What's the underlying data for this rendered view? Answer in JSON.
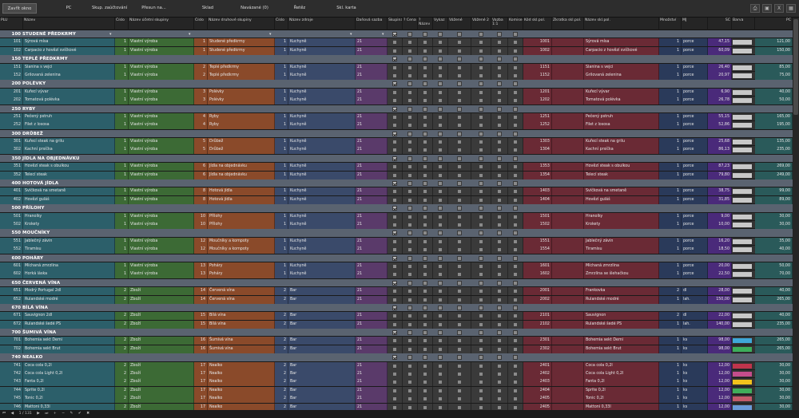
{
  "toolbar": {
    "buttons": [
      "Zavřít okno",
      "PC",
      "Skup. zaúčtování",
      "Přesun na...",
      "Sklad",
      "Navázané (0)",
      "Řetěz",
      "Skl. karta"
    ],
    "icons": [
      "print-icon",
      "printer-icon",
      "excel-icon",
      "layout-icon"
    ]
  },
  "headers": [
    "PLU",
    "Název",
    "Číslo",
    "Název účetní skupiny",
    "Číslo",
    "Název druhové skupiny",
    "Číslo",
    "Název zdroje",
    "Daňová sazba",
    "Skupina",
    "? Cena",
    "? Název",
    "Vykaz",
    "Vážené",
    "Vážené 2",
    "Vazba 1:1",
    "Komise",
    "Kód skl.pol.",
    "Zkratka skl.pol.",
    "Název skl.pol.",
    "Množství",
    "MJ",
    "SC",
    "Barva",
    "PC"
  ],
  "groups": [
    {
      "plu": "100",
      "title": "STUDENÉ PŘEDKRMY",
      "items": [
        {
          "plu": "101",
          "name": "Sýrová mísa",
          "ucet": "1",
          "ucet_name": "Vlastní výroba",
          "druh": "1",
          "druh_name": "Studené předkrmy",
          "zdroj": "1",
          "zdroj_name": "Kuchyně",
          "dph": "21",
          "kod": "1001",
          "skl_name": "Sýrová mísa",
          "mnoz": "1",
          "mj": "porce",
          "sc": "47,15",
          "barva": "",
          "pc": "121,00"
        },
        {
          "plu": "102",
          "name": "Carpacio z hovězí svíčkové",
          "ucet": "1",
          "ucet_name": "Vlastní výroba",
          "druh": "1",
          "druh_name": "Studené předkrmy",
          "zdroj": "1",
          "zdroj_name": "Kuchyně",
          "dph": "21",
          "kod": "1002",
          "skl_name": "Carpacio z hovězí svíčkové",
          "mnoz": "1",
          "mj": "porce",
          "sc": "60,09",
          "barva": "",
          "pc": "150,00"
        }
      ]
    },
    {
      "plu": "150",
      "title": "TEPLÉ PŘEDKRMY",
      "items": [
        {
          "plu": "151",
          "name": "Slanina s vejci",
          "ucet": "1",
          "ucet_name": "Vlastní výroba",
          "druh": "2",
          "druh_name": "Teplé předkrmy",
          "zdroj": "1",
          "zdroj_name": "Kuchyně",
          "dph": "21",
          "kod": "1151",
          "skl_name": "Slanina s vejci",
          "mnoz": "1",
          "mj": "porce",
          "sc": "26,40",
          "barva": "",
          "pc": "85,00"
        },
        {
          "plu": "152",
          "name": "Grilovaná zelenina",
          "ucet": "1",
          "ucet_name": "Vlastní výroba",
          "druh": "2",
          "druh_name": "Teplé předkrmy",
          "zdroj": "1",
          "zdroj_name": "Kuchyně",
          "dph": "21",
          "kod": "1152",
          "skl_name": "Grilovaná zelenina",
          "mnoz": "1",
          "mj": "porce",
          "sc": "20,97",
          "barva": "",
          "pc": "75,00"
        }
      ]
    },
    {
      "plu": "200",
      "title": "POLÉVKY",
      "items": [
        {
          "plu": "201",
          "name": "Kuřecí vývar",
          "ucet": "1",
          "ucet_name": "Vlastní výroba",
          "druh": "3",
          "druh_name": "Polévky",
          "zdroj": "1",
          "zdroj_name": "Kuchyně",
          "dph": "21",
          "kod": "1201",
          "skl_name": "Kuřecí vývar",
          "mnoz": "1",
          "mj": "porce",
          "sc": "6,90",
          "barva": "",
          "pc": "40,00"
        },
        {
          "plu": "202",
          "name": "Tomatová polévka",
          "ucet": "1",
          "ucet_name": "Vlastní výroba",
          "druh": "3",
          "druh_name": "Polévky",
          "zdroj": "1",
          "zdroj_name": "Kuchyně",
          "dph": "21",
          "kod": "1202",
          "skl_name": "Tomatová polévka",
          "mnoz": "1",
          "mj": "porce",
          "sc": "26,78",
          "barva": "",
          "pc": "50,00"
        }
      ]
    },
    {
      "plu": "250",
      "title": "RYBY",
      "items": [
        {
          "plu": "251",
          "name": "Pečený pstruh",
          "ucet": "1",
          "ucet_name": "Vlastní výroba",
          "druh": "4",
          "druh_name": "Ryby",
          "zdroj": "1",
          "zdroj_name": "Kuchyně",
          "dph": "21",
          "kod": "1251",
          "skl_name": "Pečený pstruh",
          "mnoz": "1",
          "mj": "porce",
          "sc": "55,15",
          "barva": "",
          "pc": "165,00"
        },
        {
          "plu": "252",
          "name": "Filet z lososa",
          "ucet": "1",
          "ucet_name": "Vlastní výroba",
          "druh": "4",
          "druh_name": "Ryby",
          "zdroj": "1",
          "zdroj_name": "Kuchyně",
          "dph": "21",
          "kod": "1252",
          "skl_name": "Filet z lososa",
          "mnoz": "1",
          "mj": "porce",
          "sc": "52,86",
          "barva": "",
          "pc": "195,00"
        }
      ]
    },
    {
      "plu": "300",
      "title": "DRŮBEŽ",
      "items": [
        {
          "plu": "301",
          "name": "Kuřecí steak na grilu",
          "ucet": "1",
          "ucet_name": "Vlastní výroba",
          "druh": "5",
          "druh_name": "Drůbež",
          "zdroj": "1",
          "zdroj_name": "Kuchyně",
          "dph": "21",
          "kod": "1303",
          "skl_name": "Kuřecí steak na grilu",
          "mnoz": "1",
          "mj": "porce",
          "sc": "25,68",
          "barva": "",
          "pc": "135,00"
        },
        {
          "plu": "302",
          "name": "Kachní prsíčka",
          "ucet": "1",
          "ucet_name": "Vlastní výroba",
          "druh": "5",
          "druh_name": "Drůbež",
          "zdroj": "1",
          "zdroj_name": "Kuchyně",
          "dph": "21",
          "kod": "1304",
          "skl_name": "Kachní prsíčka",
          "mnoz": "1",
          "mj": "porce",
          "sc": "86,13",
          "barva": "",
          "pc": "235,00"
        }
      ]
    },
    {
      "plu": "350",
      "title": "JÍDLA NA OBJEDNÁVKU",
      "items": [
        {
          "plu": "351",
          "name": "Hovězí steak s obulkou",
          "ucet": "1",
          "ucet_name": "Vlastní výroba",
          "druh": "6",
          "druh_name": "Jídla na objednávku",
          "zdroj": "1",
          "zdroj_name": "Kuchyně",
          "dph": "21",
          "kod": "1353",
          "skl_name": "Hovězí steak s obulkou",
          "mnoz": "1",
          "mj": "porce",
          "sc": "87,23",
          "barva": "",
          "pc": "269,00"
        },
        {
          "plu": "352",
          "name": "Telecí steak",
          "ucet": "1",
          "ucet_name": "Vlastní výroba",
          "druh": "6",
          "druh_name": "Jídla na objednávku",
          "zdroj": "1",
          "zdroj_name": "Kuchyně",
          "dph": "21",
          "kod": "1354",
          "skl_name": "Telecí steak",
          "mnoz": "1",
          "mj": "porce",
          "sc": "79,80",
          "barva": "",
          "pc": "249,00"
        }
      ]
    },
    {
      "plu": "400",
      "title": "HOTOVÁ JÍDLA",
      "items": [
        {
          "plu": "401",
          "name": "Svíčková na smetaně",
          "ucet": "1",
          "ucet_name": "Vlastní výroba",
          "druh": "8",
          "druh_name": "Hotová jídla",
          "zdroj": "1",
          "zdroj_name": "Kuchyně",
          "dph": "21",
          "kod": "1403",
          "skl_name": "Svíčková na smetaně",
          "mnoz": "1",
          "mj": "porce",
          "sc": "38,75",
          "barva": "",
          "pc": "99,00"
        },
        {
          "plu": "402",
          "name": "Hovězí guláš",
          "ucet": "1",
          "ucet_name": "Vlastní výroba",
          "druh": "8",
          "druh_name": "Hotová jídla",
          "zdroj": "1",
          "zdroj_name": "Kuchyně",
          "dph": "21",
          "kod": "1404",
          "skl_name": "Hovězí guláš",
          "mnoz": "1",
          "mj": "porce",
          "sc": "31,85",
          "barva": "",
          "pc": "89,00"
        }
      ]
    },
    {
      "plu": "500",
      "title": "PŘÍLOHY",
      "items": [
        {
          "plu": "501",
          "name": "Hranolky",
          "ucet": "1",
          "ucet_name": "Vlastní výroba",
          "druh": "10",
          "druh_name": "Přílohy",
          "zdroj": "1",
          "zdroj_name": "Kuchyně",
          "dph": "21",
          "kod": "1501",
          "skl_name": "Hranolky",
          "mnoz": "1",
          "mj": "porce",
          "sc": "9,00",
          "barva": "",
          "pc": "30,00"
        },
        {
          "plu": "502",
          "name": "Krokety",
          "ucet": "1",
          "ucet_name": "Vlastní výroba",
          "druh": "10",
          "druh_name": "Přílohy",
          "zdroj": "1",
          "zdroj_name": "Kuchyně",
          "dph": "21",
          "kod": "1502",
          "skl_name": "Krokety",
          "mnoz": "1",
          "mj": "porce",
          "sc": "10,00",
          "barva": "",
          "pc": "30,00"
        }
      ]
    },
    {
      "plu": "550",
      "title": "MOUČNÍKY",
      "items": [
        {
          "plu": "551",
          "name": "Jablečný závin",
          "ucet": "1",
          "ucet_name": "Vlastní výroba",
          "druh": "12",
          "druh_name": "Moučníky a kompoty",
          "zdroj": "1",
          "zdroj_name": "Kuchyně",
          "dph": "21",
          "kod": "1551",
          "skl_name": "Jablečný závin",
          "mnoz": "1",
          "mj": "porce",
          "sc": "16,20",
          "barva": "",
          "pc": "35,00"
        },
        {
          "plu": "552",
          "name": "Tiramisu",
          "ucet": "1",
          "ucet_name": "Vlastní výroba",
          "druh": "12",
          "druh_name": "Moučníky a kompoty",
          "zdroj": "1",
          "zdroj_name": "Kuchyně",
          "dph": "21",
          "kod": "1554",
          "skl_name": "Tiramisu",
          "mnoz": "1",
          "mj": "porce",
          "sc": "18,50",
          "barva": "",
          "pc": "40,00"
        }
      ]
    },
    {
      "plu": "600",
      "title": "POHÁRY",
      "items": [
        {
          "plu": "601",
          "name": "Míchaná zmrzlina",
          "ucet": "1",
          "ucet_name": "Vlastní výroba",
          "druh": "13",
          "druh_name": "Poháry",
          "zdroj": "1",
          "zdroj_name": "Kuchyně",
          "dph": "21",
          "kod": "1601",
          "skl_name": "Míchaná zmrzlina",
          "mnoz": "1",
          "mj": "porce",
          "sc": "20,00",
          "barva": "",
          "pc": "50,00"
        },
        {
          "plu": "602",
          "name": "Horká láska",
          "ucet": "1",
          "ucet_name": "Vlastní výroba",
          "druh": "13",
          "druh_name": "Poháry",
          "zdroj": "1",
          "zdroj_name": "Kuchyně",
          "dph": "21",
          "kod": "1602",
          "skl_name": "Zmrzlina se šlehačkou",
          "mnoz": "1",
          "mj": "porce",
          "sc": "22,50",
          "barva": "",
          "pc": "70,00"
        }
      ]
    },
    {
      "plu": "650",
      "title": "ČERVENÁ VÍNA",
      "items": [
        {
          "plu": "651",
          "name": "Modrý Portugal 2dl",
          "ucet": "2",
          "ucet_name": "Zboží",
          "druh": "14",
          "druh_name": "Červená vína",
          "zdroj": "2",
          "zdroj_name": "Bar",
          "dph": "21",
          "kod": "2001",
          "skl_name": "Frankovka",
          "mnoz": "2",
          "mj": "dl",
          "sc": "28,00",
          "barva": "",
          "pc": "40,00"
        },
        {
          "plu": "652",
          "name": "Rulandské modré",
          "ucet": "2",
          "ucet_name": "Zboží",
          "druh": "14",
          "druh_name": "Červená vína",
          "zdroj": "2",
          "zdroj_name": "Bar",
          "dph": "21",
          "kod": "2002",
          "skl_name": "Rulandské modré",
          "mnoz": "1",
          "mj": "lah.",
          "sc": "150,00",
          "barva": "",
          "pc": "265,00"
        }
      ]
    },
    {
      "plu": "670",
      "title": "BÍLÁ VÍNA",
      "items": [
        {
          "plu": "671",
          "name": "Sauvignon 2dl",
          "ucet": "2",
          "ucet_name": "Zboží",
          "druh": "15",
          "druh_name": "Bílá vína",
          "zdroj": "2",
          "zdroj_name": "Bar",
          "dph": "21",
          "kod": "2101",
          "skl_name": "Sauvignon",
          "mnoz": "2",
          "mj": "dl",
          "sc": "22,00",
          "barva": "",
          "pc": "40,00"
        },
        {
          "plu": "672",
          "name": "Rulandské šedé PS",
          "ucet": "2",
          "ucet_name": "Zboží",
          "druh": "15",
          "druh_name": "Bílá vína",
          "zdroj": "2",
          "zdroj_name": "Bar",
          "dph": "21",
          "kod": "2102",
          "skl_name": "Rulandské šedé PS",
          "mnoz": "1",
          "mj": "lah.",
          "sc": "140,00",
          "barva": "",
          "pc": "235,00"
        }
      ]
    },
    {
      "plu": "700",
      "title": "ŠUMIVÁ VÍNA",
      "items": [
        {
          "plu": "701",
          "name": "Bohemia sekt Demi",
          "ucet": "2",
          "ucet_name": "Zboží",
          "druh": "16",
          "druh_name": "Šumivá vína",
          "zdroj": "2",
          "zdroj_name": "Bar",
          "dph": "21",
          "kod": "2301",
          "skl_name": "Bohemia sekt Demi",
          "mnoz": "1",
          "mj": "ks",
          "sc": "98,00",
          "barva": "#3fa8d8",
          "pc": "265,00"
        },
        {
          "plu": "702",
          "name": "Bohemia sekt Brut",
          "ucet": "2",
          "ucet_name": "Zboží",
          "druh": "16",
          "druh_name": "Šumivá vína",
          "zdroj": "2",
          "zdroj_name": "Bar",
          "dph": "21",
          "kod": "2302",
          "skl_name": "Bohemia sekt Brut",
          "mnoz": "1",
          "mj": "ks",
          "sc": "98,00",
          "barva": "#3cae5a",
          "pc": "265,00"
        }
      ]
    },
    {
      "plu": "740",
      "title": "NEALKO",
      "items": [
        {
          "plu": "741",
          "name": "Coca cola 0,2l",
          "ucet": "2",
          "ucet_name": "Zboží",
          "druh": "17",
          "druh_name": "Nealko",
          "zdroj": "2",
          "zdroj_name": "Bar",
          "dph": "21",
          "kod": "2401",
          "skl_name": "Coca cola 0,2l",
          "mnoz": "1",
          "mj": "ks",
          "sc": "12,00",
          "barva": "#c0344c",
          "pc": "30,00"
        },
        {
          "plu": "742",
          "name": "Coca cola Light 0,2l",
          "ucet": "2",
          "ucet_name": "Zboží",
          "druh": "17",
          "druh_name": "Nealko",
          "zdroj": "2",
          "zdroj_name": "Bar",
          "dph": "21",
          "kod": "2402",
          "skl_name": "Coca cola Light 0,2l",
          "mnoz": "1",
          "mj": "ks",
          "sc": "12,00",
          "barva": "#c44d8c",
          "pc": "30,00"
        },
        {
          "plu": "743",
          "name": "Fanta 0,2l",
          "ucet": "2",
          "ucet_name": "Zboží",
          "druh": "17",
          "druh_name": "Nealko",
          "zdroj": "2",
          "zdroj_name": "Bar",
          "dph": "21",
          "kod": "2403",
          "skl_name": "Fanta 0,2l",
          "mnoz": "1",
          "mj": "ks",
          "sc": "12,00",
          "barva": "#f2c21c",
          "pc": "30,00"
        },
        {
          "plu": "744",
          "name": "Sprite 0,2l",
          "ucet": "2",
          "ucet_name": "Zboží",
          "druh": "17",
          "druh_name": "Nealko",
          "zdroj": "2",
          "zdroj_name": "Bar",
          "dph": "21",
          "kod": "2404",
          "skl_name": "Sprite 0,2l",
          "mnoz": "1",
          "mj": "ks",
          "sc": "12,00",
          "barva": "#3fae5a",
          "pc": "30,00"
        },
        {
          "plu": "745",
          "name": "Tonic 0,2l",
          "ucet": "2",
          "ucet_name": "Zboží",
          "druh": "17",
          "druh_name": "Nealko",
          "zdroj": "2",
          "zdroj_name": "Bar",
          "dph": "21",
          "kod": "2405",
          "skl_name": "Tonic 0,2l",
          "mnoz": "1",
          "mj": "ks",
          "sc": "12,00",
          "barva": "#c45a6a",
          "pc": "30,00"
        },
        {
          "plu": "746",
          "name": "Mattoni 0,33l",
          "ucet": "2",
          "ucet_name": "Zboží",
          "druh": "17",
          "druh_name": "Nealko",
          "zdroj": "2",
          "zdroj_name": "Bar",
          "dph": "21",
          "kod": "2405",
          "skl_name": "Mattoni 0,33l",
          "mnoz": "1",
          "mj": "ks",
          "sc": "12,00",
          "barva": "#6a9ad8",
          "pc": "30,00"
        }
      ]
    }
  ],
  "colors": {
    "plu_bg": "#2c5f6a",
    "ucet_bg": "#3c6a35",
    "druh_bg": "#8a4a2a",
    "zdroj_bg": "#3a4a6a",
    "dph_bg": "#5a3a6a",
    "flags_bg": "#3a3a3a",
    "skl_bg": "#6a2a35",
    "mnoz_bg": "#2a3a5a",
    "sc_bg": "#4a2a7a",
    "pc_bg": "#2a5a5a",
    "group_bg": "#5a6370"
  },
  "status": {
    "page": "1 / 131"
  }
}
